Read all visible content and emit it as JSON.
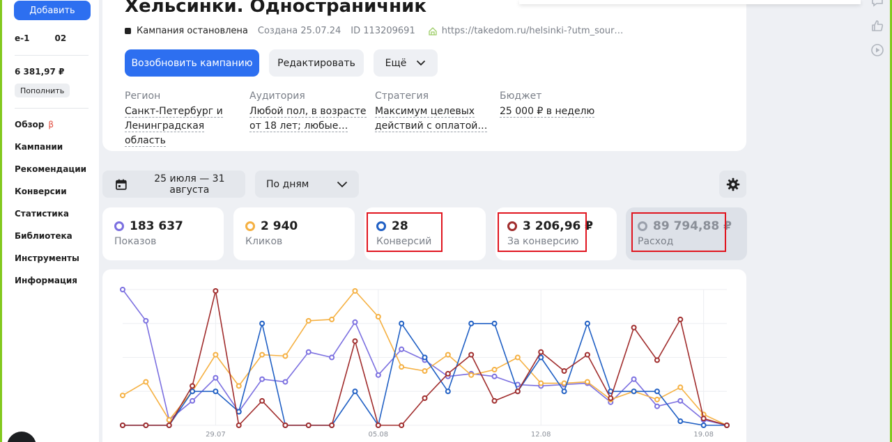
{
  "sidebar": {
    "add_label": "Добавить",
    "account_left": "e-1",
    "account_right": "02",
    "balance": "6 381,97 ₽",
    "topup_label": "Пополнить",
    "nav": [
      {
        "label": "Обзор",
        "badge": "β"
      },
      {
        "label": "Кампании"
      },
      {
        "label": "Рекомендации"
      },
      {
        "label": "Конверсии"
      },
      {
        "label": "Статистика"
      },
      {
        "label": "Библиотека"
      },
      {
        "label": "Инструменты"
      },
      {
        "label": "Информация"
      }
    ]
  },
  "campaign": {
    "title": "Хельсинки. Одностраничник",
    "status": "Кампания остановлена",
    "created": "Создана 25.07.24",
    "id": "ID 113209691",
    "url": "https://takedom.ru/helsinki-?utm_sour…",
    "resume_label": "Возобновить кампанию",
    "edit_label": "Редактировать",
    "more_label": "Ещё",
    "params": [
      {
        "label": "Регион",
        "value_1": "Санкт-Петербург и",
        "value_2": "Ленинградская область"
      },
      {
        "label": "Аудитория",
        "value_1": "Любой пол, в возрасте",
        "value_2": "от 18 лет; любые…"
      },
      {
        "label": "Стратегия",
        "value_1": "Максимум целевых",
        "value_2": "действий с оплатой…"
      },
      {
        "label": "Бюджет",
        "value_1": "25 000 ₽ в неделю",
        "value_2": ""
      }
    ]
  },
  "controls": {
    "date_range": "25 июля — 31 августа",
    "grouping": "По дням"
  },
  "metrics": [
    {
      "value": "183 637",
      "label": "Показов",
      "color": "#7b6fe0"
    },
    {
      "value": "2 940",
      "label": "Кликов",
      "color": "#f5b041"
    },
    {
      "value": "28",
      "label": "Конверсий",
      "color": "#1f5fc4"
    },
    {
      "value": "3 206,96 ₽",
      "label": "За конверсию",
      "color": "#a02c2c"
    },
    {
      "value": "89 794,88 ₽",
      "label": "Расход",
      "color": "#9aa0ab"
    }
  ],
  "colors": {
    "accent": "#2d6ff0",
    "highlight": "#e0141e",
    "impressions": "#7b6fe0",
    "clicks": "#f5b041",
    "conversions": "#1f5fc4",
    "cost_per_conversion": "#a02c2c"
  },
  "chart_data": {
    "type": "line",
    "x_ticks": [
      "29.07",
      "05.08",
      "12.08",
      "19.08"
    ],
    "x_tick_index": [
      4,
      11,
      18,
      25
    ],
    "ylim": [
      0,
      100
    ],
    "grid": true,
    "series": [
      {
        "name": "Показов",
        "color": "#7b6fe0",
        "values": [
          100,
          77,
          4,
          18,
          35,
          10,
          34,
          32,
          54,
          50,
          76,
          37,
          56,
          48,
          36,
          38,
          36,
          30,
          29,
          30,
          31,
          17,
          34,
          14,
          18,
          4,
          0
        ]
      },
      {
        "name": "Кликов",
        "color": "#f5b041",
        "values": [
          22,
          32,
          4,
          25,
          52,
          29,
          52,
          51,
          77,
          78,
          99,
          80,
          43,
          40,
          52,
          37,
          41,
          50,
          31,
          31,
          32,
          19,
          25,
          19,
          28,
          8,
          0
        ]
      },
      {
        "name": "Конверсий",
        "color": "#1f5fc4",
        "values": [
          0,
          0,
          0,
          25,
          25,
          10,
          75,
          0,
          0,
          0,
          25,
          0,
          75,
          50,
          25,
          75,
          75,
          25,
          50,
          25,
          75,
          25,
          25,
          25,
          3,
          0,
          0
        ]
      },
      {
        "name": "За конверсию",
        "color": "#a02c2c",
        "values": [
          0,
          0,
          0,
          29,
          99,
          0,
          18,
          0,
          0,
          0,
          62,
          0,
          0,
          20,
          38,
          52,
          18,
          25,
          54,
          40,
          52,
          20,
          72,
          48,
          78,
          5,
          0
        ]
      }
    ]
  },
  "rail": {
    "icons": [
      "comment-icon",
      "thumbs-up-icon",
      "play-icon"
    ]
  }
}
